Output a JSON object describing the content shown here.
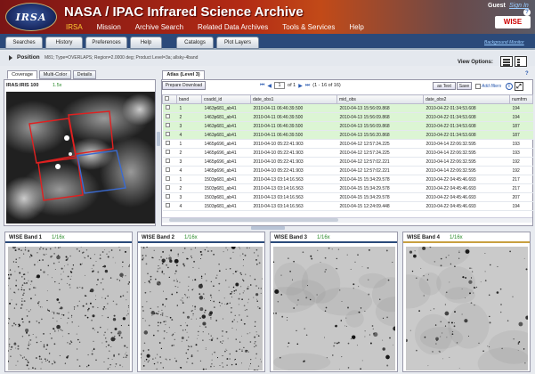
{
  "header": {
    "logo": "IRSA",
    "title": "NASA / IPAC Infrared Science Archive",
    "guest": "Guest",
    "signin": "Sign In",
    "help_icon": "?",
    "brand_logo": "WISE",
    "nav": [
      "IRSA",
      "Mission",
      "Archive Search",
      "Related Data Archives",
      "Tools & Services",
      "Help"
    ]
  },
  "menubar": {
    "tabs": [
      "Searches",
      "History",
      "Preferences",
      "Help",
      "Catalogs",
      "Plot Layers"
    ],
    "background_monitor": "Background Monitor"
  },
  "position": {
    "label": "Position",
    "info": "M81; Type=OVERLAPS; Region=2.0000 deg; Product Level=3a; allsky-4band",
    "view_options": "View Options:"
  },
  "left": {
    "tabs": [
      "Coverage",
      "Multi-Color",
      "Details"
    ],
    "image_label": "IRAS:IRIS 100",
    "zoom": "1.5x"
  },
  "atlas": {
    "tab": "Atlas (Level 3)",
    "prepare_download": "Prepare Download",
    "page_current": "1",
    "page_of": "of 1",
    "page_range": "(1 - 16 of 16)",
    "as_text": "as Text",
    "save": "Save",
    "add_filters": "Add filters",
    "filter_icon": "i",
    "expand_icon": "⤢",
    "help_mark": "?",
    "columns": [
      "",
      "band",
      "coadd_id",
      "date_obs1",
      "mid_obs",
      "date_obs2",
      "numfrm"
    ],
    "rows": [
      [
        "1",
        "1463p681_ab41",
        "2010-04-11 06:46:39.500",
        "2010-04-13 15:56:09.868",
        "2010-04-22 01:34:53.608",
        "194"
      ],
      [
        "2",
        "1463p681_ab41",
        "2010-04-11 06:46:39.500",
        "2010-04-13 15:56:09.868",
        "2010-04-22 01:34:53.608",
        "194"
      ],
      [
        "3",
        "1463p681_ab41",
        "2010-04-11 06:46:39.500",
        "2010-04-13 15:56:09.868",
        "2010-04-22 01:34:53.608",
        "187"
      ],
      [
        "4",
        "1463p681_ab41",
        "2010-04-11 06:46:39.500",
        "2010-04-13 15:56:20.868",
        "2010-04-22 01:34:53.608",
        "187"
      ],
      [
        "1",
        "1465p696_ab41",
        "2010-04-10 05:22:41.903",
        "2010-04-12 12:57:24.225",
        "2010-04-14 22:06:32.595",
        "193"
      ],
      [
        "2",
        "1465p696_ab41",
        "2010-04-10 05:22:41.903",
        "2010-04-12 12:57:24.225",
        "2010-04-14 22:06:32.595",
        "193"
      ],
      [
        "3",
        "1465p696_ab41",
        "2010-04-10 05:22:41.903",
        "2010-04-12 12:57:02.221",
        "2010-04-14 22:06:32.595",
        "192"
      ],
      [
        "4",
        "1465p696_ab41",
        "2010-04-10 05:22:41.903",
        "2010-04-12 12:57:02.221",
        "2010-04-14 22:06:32.595",
        "192"
      ],
      [
        "1",
        "1503p681_ab41",
        "2010-04-13 03:14:16.563",
        "2010-04-15 15:34:29.578",
        "2010-04-22 04:45:46.693",
        "217"
      ],
      [
        "2",
        "1503p681_ab41",
        "2010-04-13 03:14:16.563",
        "2010-04-15 15:34:29.578",
        "2010-04-22 04:45:46.693",
        "217"
      ],
      [
        "3",
        "1503p681_ab41",
        "2010-04-13 03:14:16.563",
        "2010-04-15 15:34:29.578",
        "2010-04-22 04:45:46.693",
        "207"
      ],
      [
        "4",
        "1503p681_ab41",
        "2010-04-13 03:14:16.563",
        "2010-04-15 12:24:09.448",
        "2010-04-22 04:45:46.693",
        "194"
      ]
    ]
  },
  "bands": [
    {
      "name": "WISE Band 1",
      "zoom": "1/16x",
      "color": "#2a4a7a"
    },
    {
      "name": "WISE Band 2",
      "zoom": "1/16x",
      "color": "#2a4a7a"
    },
    {
      "name": "WISE Band 3",
      "zoom": "1/16x",
      "color": "#2a4a7a"
    },
    {
      "name": "WISE Band 4",
      "zoom": "1/16x",
      "color": "#c8a040"
    }
  ]
}
